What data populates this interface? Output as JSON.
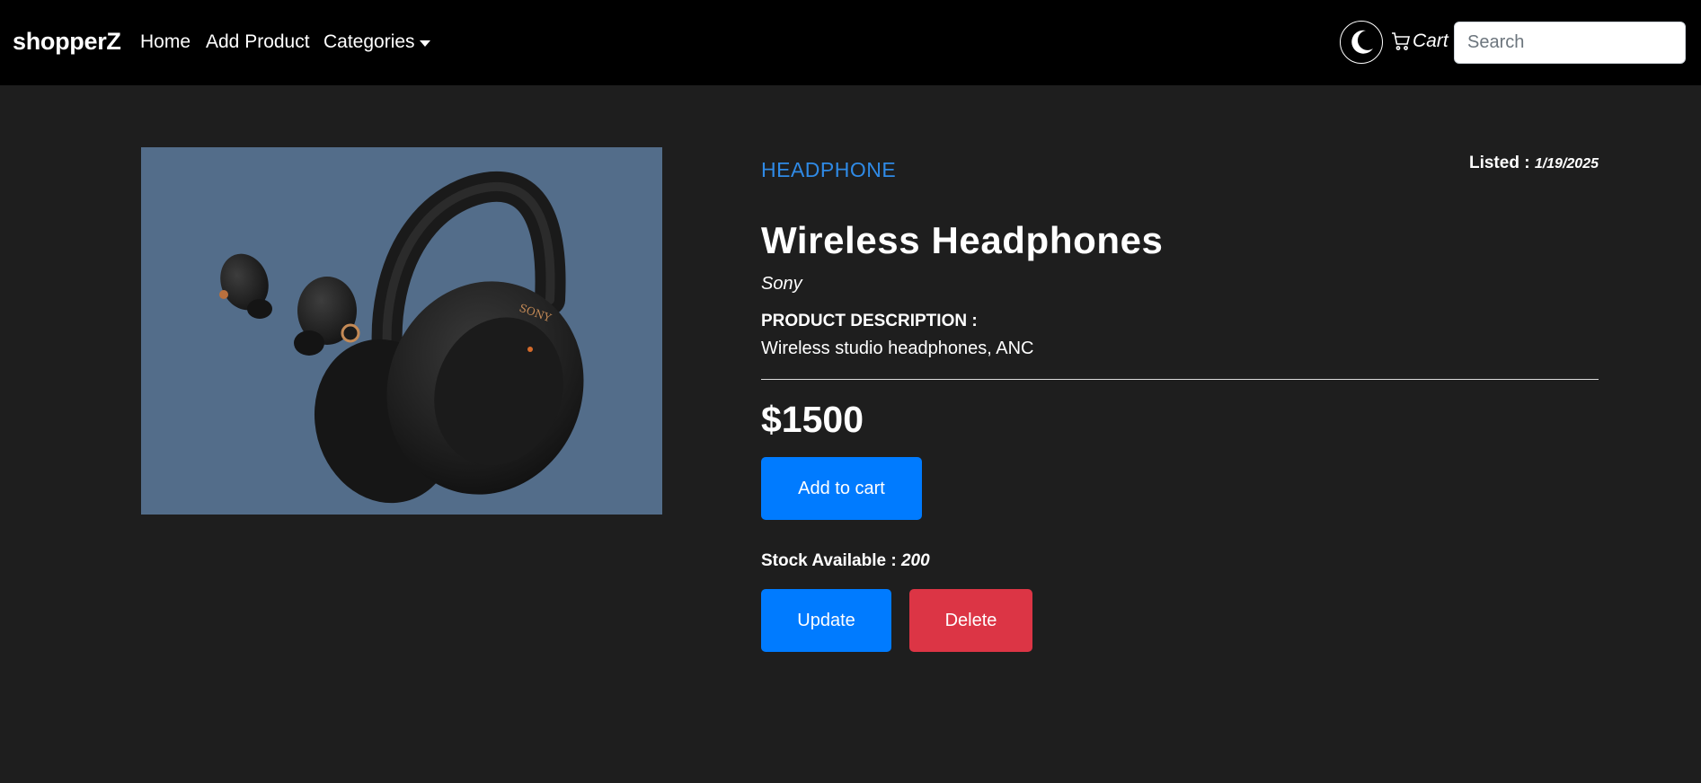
{
  "navbar": {
    "brand": "shopperZ",
    "links": {
      "home": "Home",
      "add_product": "Add Product",
      "categories": "Categories"
    },
    "theme_toggle_icon": "moon-icon",
    "cart_label": "Cart",
    "cart_icon": "cart-icon",
    "search_placeholder": "Search",
    "background_color": "#000000"
  },
  "product": {
    "category": "HEADPHONE",
    "listed_label": "Listed :",
    "listed_date": "1/19/2025",
    "name": "Wireless Headphones",
    "brand": "Sony",
    "description_label": "PRODUCT DESCRIPTION :",
    "description": "Wireless studio headphones, ANC",
    "price": "$1500",
    "stock_label": "Stock Available :",
    "stock_value": "200",
    "image_alt": "headphones-and-earbuds-image"
  },
  "actions": {
    "add_to_cart": "Add to cart",
    "update": "Update",
    "delete": "Delete"
  },
  "colors": {
    "page_background": "#1e1e1e",
    "category_blue": "#2f8ae6",
    "primary": "#007bff",
    "danger": "#dc3545"
  }
}
